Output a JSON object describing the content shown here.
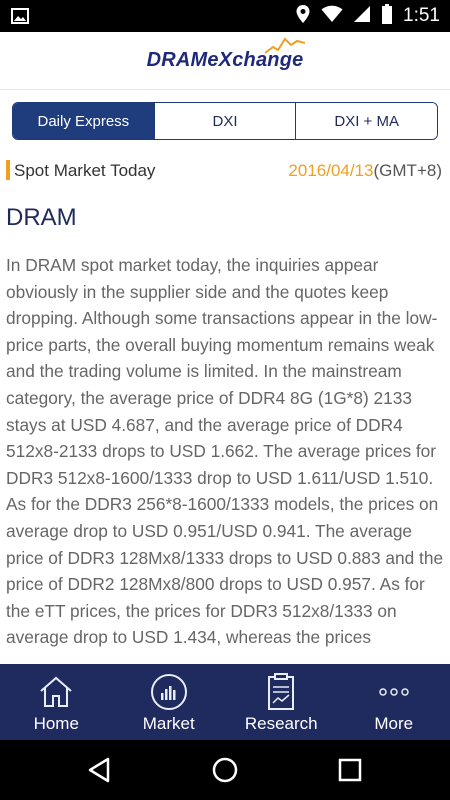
{
  "status_bar": {
    "time": "1:51",
    "icons": [
      "image-icon",
      "location-icon",
      "wifi-icon",
      "signal-icon",
      "battery-icon"
    ]
  },
  "header": {
    "logo_text": "DRAMeXchange",
    "logo_color": "#1f2a7a",
    "accent_color": "#f0a020"
  },
  "tabs": [
    {
      "label": "Daily Express",
      "active": true
    },
    {
      "label": "DXI",
      "active": false
    },
    {
      "label": "DXI + MA",
      "active": false
    }
  ],
  "section": {
    "title": "Spot Market Today",
    "date": "2016/04/13",
    "timezone": "(GMT+8)"
  },
  "article": {
    "title": "DRAM",
    "body": "In DRAM spot market today, the inquiries appear obviously in the supplier side and the quotes keep dropping. Although some transactions appear in the low-price parts, the overall buying momentum remains weak and the trading volume is limited. In the mainstream category, the average price of DDR4 8G (1G*8) 2133 stays at USD 4.687, and the average price of DDR4 512x8-2133 drops to USD 1.662. The average prices for DDR3 512x8-1600/1333 drop to USD 1.611/USD 1.510. As for the DDR3 256*8-1600/1333 models, the prices on average drop to USD 0.951/USD 0.941. The average price of DDR3 128Mx8/1333 drops to USD 0.883 and the price of DDR2 128Mx8/800 drops to USD 0.957. As for the eTT prices, the prices for DDR3 512x8/1333 on average drop to USD 1.434, whereas the prices"
  },
  "bottom_nav": [
    {
      "label": "Home",
      "icon": "home-icon"
    },
    {
      "label": "Market",
      "icon": "market-chart-icon"
    },
    {
      "label": "Research",
      "icon": "research-report-icon"
    },
    {
      "label": "More",
      "icon": "more-dots-icon"
    }
  ]
}
